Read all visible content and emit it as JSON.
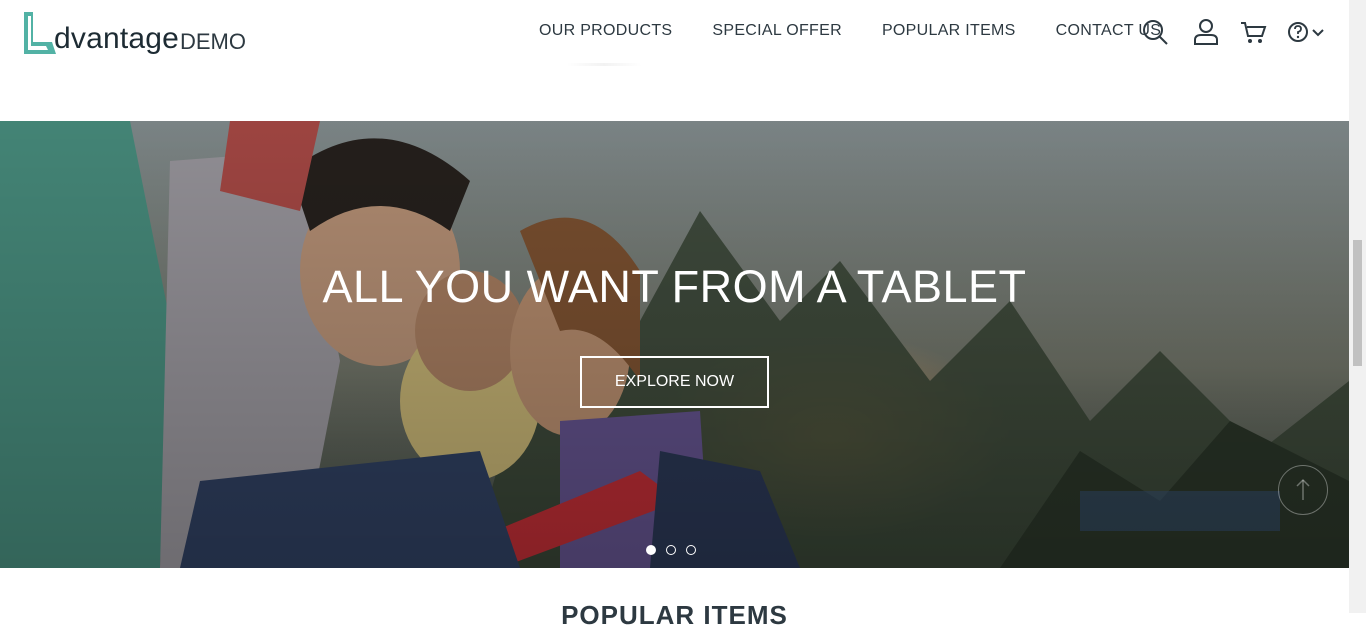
{
  "brand": {
    "name": "dvantage",
    "suffix": "DEMO",
    "accent": "#52b2a5"
  },
  "nav": {
    "items": [
      {
        "label": "OUR PRODUCTS"
      },
      {
        "label": "SPECIAL OFFER"
      },
      {
        "label": "POPULAR ITEMS"
      },
      {
        "label": "CONTACT US"
      }
    ]
  },
  "icons": [
    "search-icon",
    "user-icon",
    "cart-icon",
    "help-icon",
    "chevron-down-icon"
  ],
  "hero": {
    "title": "ALL YOU WANT FROM A TABLET",
    "cta": "EXPLORE NOW",
    "slides": 3,
    "active_slide": 1
  },
  "section": {
    "title": "POPULAR ITEMS"
  }
}
